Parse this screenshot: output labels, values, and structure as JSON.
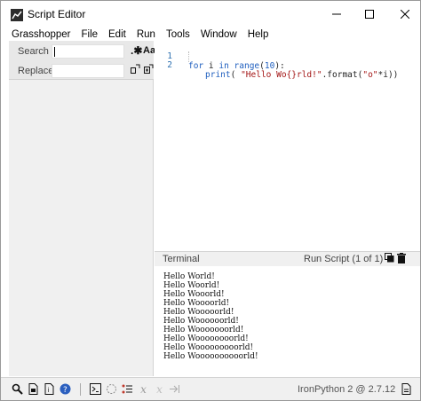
{
  "window": {
    "title": "Script Editor"
  },
  "menu": [
    "Grasshopper",
    "File",
    "Edit",
    "Run",
    "Tools",
    "Window",
    "Help"
  ],
  "find": {
    "search_label": "Search",
    "replace_label": "Replace",
    "search_value": "",
    "replace_value": ""
  },
  "editor": {
    "lines": [
      {
        "num": "1",
        "kw1": "for",
        "t1": " i ",
        "kw2": "in",
        "t2": " ",
        "fn": "range",
        "t3": "(",
        "n": "10",
        "t4": "):"
      },
      {
        "num": "2",
        "fn": "print",
        "t1": "( ",
        "s1": "\"Hello Wo{}rld!\"",
        "t2": ".format(",
        "s2": "\"o\"",
        "t3": "*i))"
      }
    ]
  },
  "terminal": {
    "title": "Terminal",
    "run_status": "Run Script (1 of 1)",
    "output": [
      "Hello World!",
      "Hello Woorld!",
      "Hello Wooorld!",
      "Hello Woooorld!",
      "Hello Wooooorld!",
      "Hello Woooooorld!",
      "Hello Wooooooorld!",
      "Hello Woooooooorld!",
      "Hello Wooooooooorld!",
      "Hello Woooooooooorld!"
    ]
  },
  "status": {
    "engine": "IronPython 2 @ 2.7.12"
  },
  "icons": {
    "search": "search-icon",
    "regex": "regex-icon",
    "match_case": "match-case-icon",
    "replace_one": "replace-icon",
    "replace_all": "replace-all-icon",
    "copy": "copy-icon",
    "clear": "trash-icon"
  },
  "colors": {
    "keyword": "#1f5fbf",
    "string": "#a31515",
    "line_number": "#2b6fb0",
    "panel": "#f0f0f0"
  }
}
